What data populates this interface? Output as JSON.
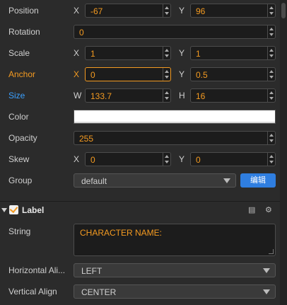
{
  "colors": {
    "accent": "#f39a21",
    "blue": "#3aa0ff",
    "button": "#2f7ee0",
    "color_value": "#ffffff"
  },
  "position": {
    "label": "Position",
    "x_axis": "X",
    "x": "-67",
    "y_axis": "Y",
    "y": "96"
  },
  "rotation": {
    "label": "Rotation",
    "value": "0"
  },
  "scale": {
    "label": "Scale",
    "x_axis": "X",
    "x": "1",
    "y_axis": "Y",
    "y": "1"
  },
  "anchor": {
    "label": "Anchor",
    "x_axis": "X",
    "x": "0",
    "y_axis": "Y",
    "y": "0.5"
  },
  "size": {
    "label": "Size",
    "w_axis": "W",
    "w": "133.7",
    "h_axis": "H",
    "h": "16"
  },
  "color": {
    "label": "Color"
  },
  "opacity": {
    "label": "Opacity",
    "value": "255"
  },
  "skew": {
    "label": "Skew",
    "x_axis": "X",
    "x": "0",
    "y_axis": "Y",
    "y": "0"
  },
  "group": {
    "label": "Group",
    "value": "default",
    "edit_label": "编辑"
  },
  "label_section": {
    "title": "Label",
    "enabled": true,
    "icons": [
      "book-icon",
      "gear-icon"
    ]
  },
  "string": {
    "label": "String",
    "value": "CHARACTER NAME:"
  },
  "horizontal_align": {
    "label": "Horizontal Ali...",
    "value": "LEFT"
  },
  "vertical_align": {
    "label": "Vertical Align",
    "value": "CENTER"
  }
}
